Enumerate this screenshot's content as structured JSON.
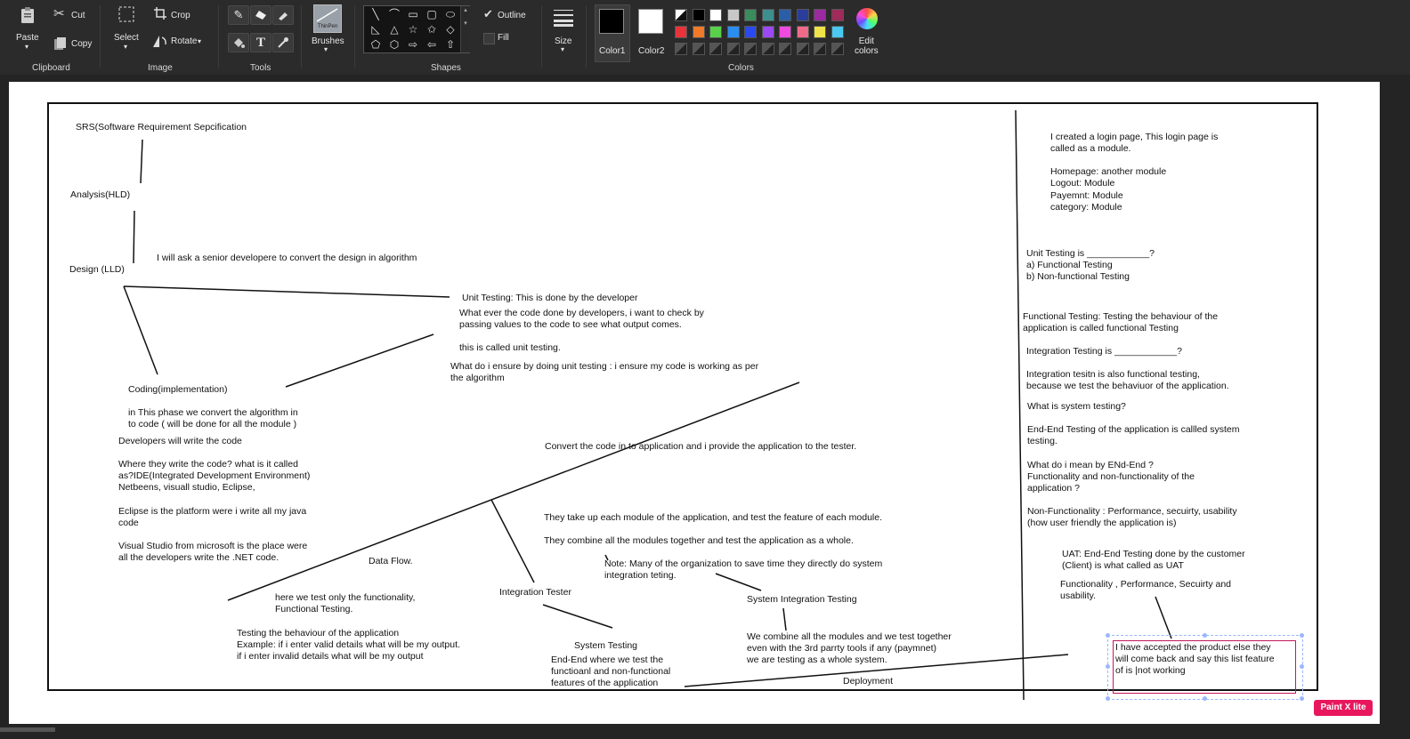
{
  "ribbon": {
    "clipboard": {
      "paste": "Paste",
      "cut": "Cut",
      "copy": "Copy",
      "group": "Clipboard"
    },
    "image": {
      "select": "Select",
      "crop": "Crop",
      "rotate": "Rotate",
      "group": "Image"
    },
    "tools": {
      "group": "Tools"
    },
    "brushes": {
      "label": "Brushes",
      "thumb": "ThinPen"
    },
    "shapes": {
      "outline": "Outline",
      "fill": "Fill",
      "group": "Shapes"
    },
    "size": {
      "label": "Size"
    },
    "colors": {
      "color1": "Color1",
      "color2": "Color2",
      "edit": "Edit",
      "edit2": "colors",
      "group": "Colors",
      "color1_value": "#000000",
      "color2_value": "#ffffff",
      "palette_row1": [
        "#000000",
        "#ffffff",
        "#c8c8c8",
        "#3a8c5c",
        "#3d8f8f",
        "#2a5fa8",
        "#2a3d9b",
        "#9b2aa0",
        "#a02a5a"
      ],
      "palette_row2": [
        "#e8333a",
        "#f07a2a",
        "#5ad14a",
        "#2a8ef0",
        "#2a4af0",
        "#9a4af0",
        "#f04ae0",
        "#f06a8a",
        "#f0e04a",
        "#4ac8f0"
      ]
    }
  },
  "canvas": {
    "texts": {
      "srs": "SRS(Software Requirement Sepcification",
      "analysis": "Analysis(HLD)",
      "design": "Design (LLD)",
      "senior": "I will ask a senior developere to convert the design in algorithm",
      "unit_title": "Unit Testing: This is done by the developer",
      "unit_desc1": "What ever the code done by developers, i want to check by",
      "unit_desc2": "passing values to the code to see what output comes.",
      "unit_called": "this is called unit testing.",
      "ensure1": "What do i ensure by doing unit testing : i ensure my code is working as per",
      "ensure2": "the algorithm",
      "coding": "Coding(implementation)",
      "phase1": "in This phase we convert the algorithm in",
      "phase2": "to code ( will be done for all the module )",
      "devs": "Developers will write the code",
      "where1": "Where they write the code? what is it called",
      "where2": "as?IDE(Integrated Development Environment)",
      "where3": "Netbeens, visuall studio, Eclipse,",
      "eclipse1": "Eclipse is the platform were i write all my java",
      "eclipse2": "code",
      "vs1": "Visual Studio from microsoft is the place were",
      "vs2": "all the developers write the .NET code.",
      "dataflow": "Data Flow.",
      "func1": "here we test only the functionality,",
      "func2": "Functional Testing.",
      "behav1": "Testing the behaviour of the application",
      "behav2": "Example: if i enter valid details what will be my output.",
      "behav3": "if i enter invalid details what will be my output",
      "convert": "Convert the code in to application and i provide the application to the tester.",
      "module1": "They take up each module of the application, and test the feature of each module.",
      "module2": "They combine all the modules together and test the application as a whole.",
      "note1": "Note: Many of the organization to save time they directly do system",
      "note2": "integration teting.",
      "integ_tester": "Integration Tester",
      "sit": "System Integration Testing",
      "systest": "System Testing",
      "e2e1": "End-End where we test the",
      "e2e2": "functioanl and non-functional",
      "e2e3": "features of the application",
      "combine1": "We combine all the modules and we test together",
      "combine2": "even with the 3rd parrty tools if any (paymnet)",
      "combine3": "we are testing as a whole system.",
      "deployment": "Deployment",
      "login1": "I created a login page, This login page is",
      "login2": "called as a module.",
      "home1": "Homepage: another module",
      "home2": "Logout: Module",
      "home3": "Payemnt: Module",
      "home4": "category: Module",
      "ut_q1": "Unit Testing is ____________?",
      "ut_q2": "a) Functional Testing",
      "ut_q3": "b) Non-functional Testing",
      "ft1": "Functional Testing: Testing the behaviour of the",
      "ft2": "application is called functional Testing",
      "it_q": "Integration Testing is ____________?",
      "it1": "Integration tesitn is also functional testing,",
      "it2": "because we test the behaviuor of the application.",
      "sys_q": "What is system testing?",
      "e2e_a1": "End-End Testing of the application is callled system",
      "e2e_a2": "testing.",
      "mean1": "What do i mean by ENd-End ?",
      "mean2": "Functionality and non-functionality of the",
      "mean3": "application ?",
      "nf1": "Non-Functionality : Performance, secuirty, usability",
      "nf2": "(how user friendly the application is)",
      "uat1": "UAT: End-End Testing done by the customer",
      "uat2": "(Client) is what called as UAT",
      "fps1": "Functionality , Performance, Secuirty and",
      "fps2": "usability.",
      "box1": "I have accepted the product else they",
      "box2": "will come back and say this list feature",
      "box3": "of is |not working"
    },
    "badge": "Paint X lite"
  }
}
